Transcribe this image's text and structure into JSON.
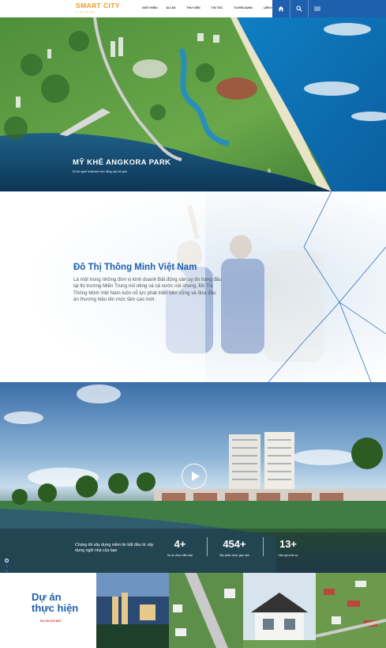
{
  "header": {
    "logo_main": "SMART CITY",
    "logo_sub": "VIETNAM",
    "nav": [
      "Giới thiệu",
      "Dự án",
      "Thư viện",
      "Tin tức",
      "Tuyển dụng",
      "Liên hệ"
    ],
    "icons": [
      "home-icon",
      "search-icon",
      "menu-icon"
    ],
    "accent_color": "#1e5fae",
    "brand_color": "#f39a1e"
  },
  "hero": {
    "title": "MỸ KHÊ ANGKORA PARK",
    "subtitle": "Đô thị nghệ thuật kiến trúc đẳng cấp thế giới",
    "slide_marker": "S"
  },
  "about": {
    "title": "Đô Thị Thông Minh Việt Nam",
    "text": "Là một trong những đơn vị kinh doanh Bất động sản uy tín hàng đầu tại thị trường Miền Trung nói riêng và cả nước nói chung, Đô Thị Thông Minh Việt Nam luôn nỗ lực phát triển bền vững và đưa đầu án thương hiệu lên mức tầm cao mới."
  },
  "video": {
    "text": "Chúng tôi xây dựng niềm tin bắt đầu từ xây dựng ngôi nhà của bạn",
    "stats": [
      {
        "num": "4+",
        "label": "Dự án được triển khai"
      },
      {
        "num": "454+",
        "label": "Sản phẩm được giao dịch"
      },
      {
        "num": "13+",
        "label": "Giải ngũ nhân sự"
      }
    ]
  },
  "projects": {
    "title_line1": "Dự án",
    "title_line2": "thực hiện",
    "link": "DỰ ÁN NỔI BẬT"
  }
}
